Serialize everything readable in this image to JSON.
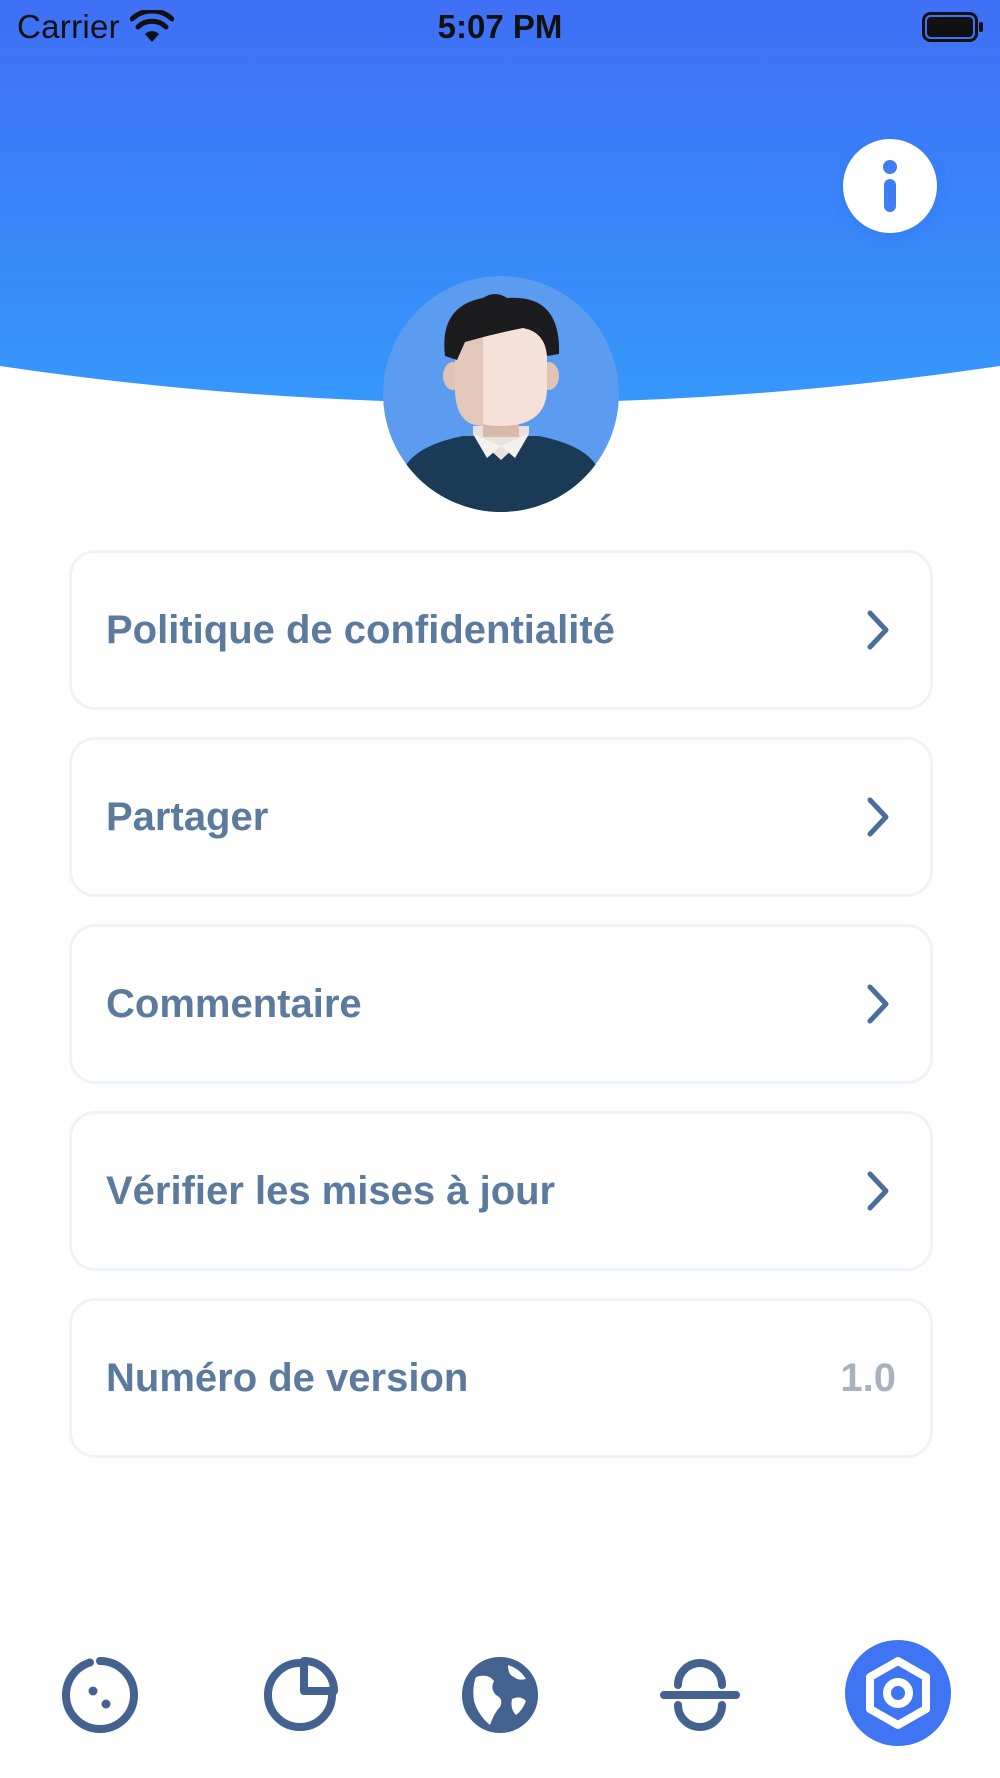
{
  "status_bar": {
    "carrier": "Carrier",
    "time": "5:07 PM"
  },
  "header": {
    "gradient_top": "#3f6ff6",
    "gradient_bottom": "#3694fb",
    "info_icon": "info-icon"
  },
  "avatar": {
    "icon": "user-avatar",
    "background": "#5b9cf0"
  },
  "menu": {
    "items": [
      {
        "label": "Politique de confidentialité",
        "icon": "chevron-right-icon"
      },
      {
        "label": "Partager",
        "icon": "chevron-right-icon"
      },
      {
        "label": "Commentaire",
        "icon": "chevron-right-icon"
      },
      {
        "label": "Vérifier les mises à jour",
        "icon": "chevron-right-icon"
      }
    ],
    "version": {
      "label": "Numéro de version",
      "value": "1.0"
    }
  },
  "tab_bar": {
    "tabs": [
      {
        "icon": "dial-icon",
        "active": false
      },
      {
        "icon": "pie-chart-icon",
        "active": false
      },
      {
        "icon": "globe-icon",
        "active": false
      },
      {
        "icon": "strikethrough-icon",
        "active": false
      },
      {
        "icon": "settings-hexagon-icon",
        "active": true
      }
    ],
    "icon_color": "#44628f",
    "active_color": "#3f74f3"
  }
}
